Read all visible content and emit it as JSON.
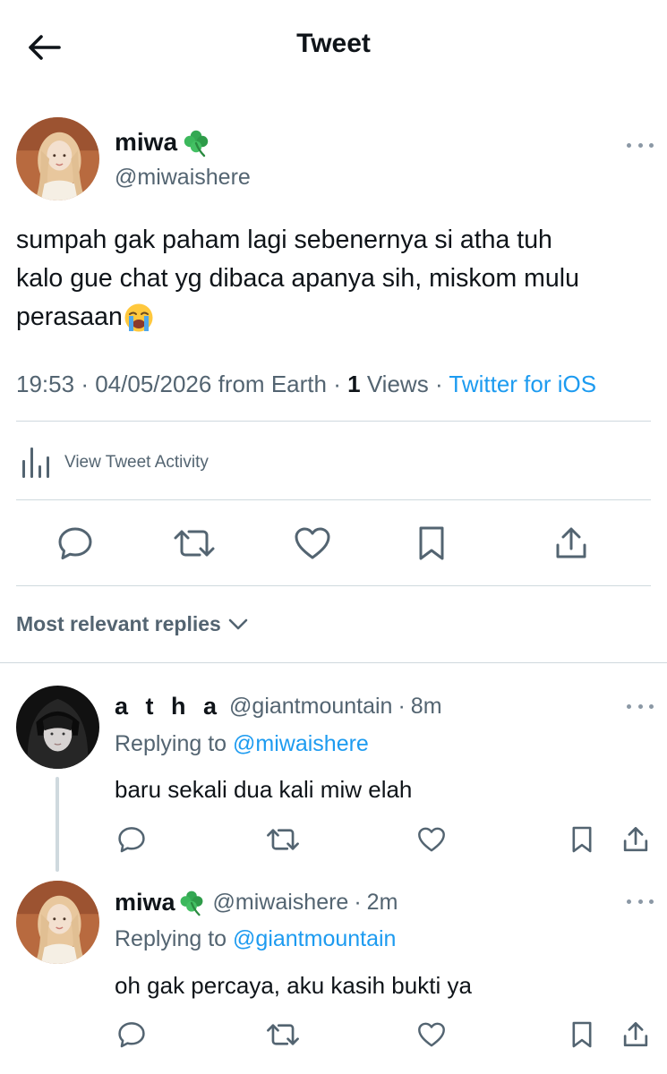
{
  "header": {
    "title": "Tweet"
  },
  "tweet": {
    "name": "miwa",
    "name_emoji": "clover-emoji",
    "handle": "@miwaishere",
    "text_line1": "sumpah gak paham lagi sebenernya si atha tuh",
    "text_line2": "kalo gue chat yg dibaca apanya sih, miskom mulu",
    "text_line3": "perasaan",
    "text_emoji": "crying-face-emoji",
    "time": "19:53",
    "date": "04/05/2026",
    "location": "from Earth",
    "views_count": "1",
    "views_label": "Views",
    "source": "Twitter for iOS"
  },
  "activity": {
    "label": "View Tweet Activity"
  },
  "sort": {
    "label": "Most relevant replies"
  },
  "replies": [
    {
      "name": "a t h a",
      "handle": "@giantmountain",
      "time": "8m",
      "replying_prefix": "Replying to",
      "replying_to": "@miwaishere",
      "text": "baru sekali dua kali miw elah"
    },
    {
      "name": "miwa",
      "handle": "@miwaishere",
      "time": "2m",
      "replying_prefix": "Replying to",
      "replying_to": "@giantmountain",
      "text": "oh gak percaya, aku kasih bukti ya"
    }
  ],
  "separator": "·",
  "colors": {
    "link": "#1d9bf0",
    "muted": "#536471",
    "text": "#0f1419",
    "divider": "#cfd9de"
  }
}
